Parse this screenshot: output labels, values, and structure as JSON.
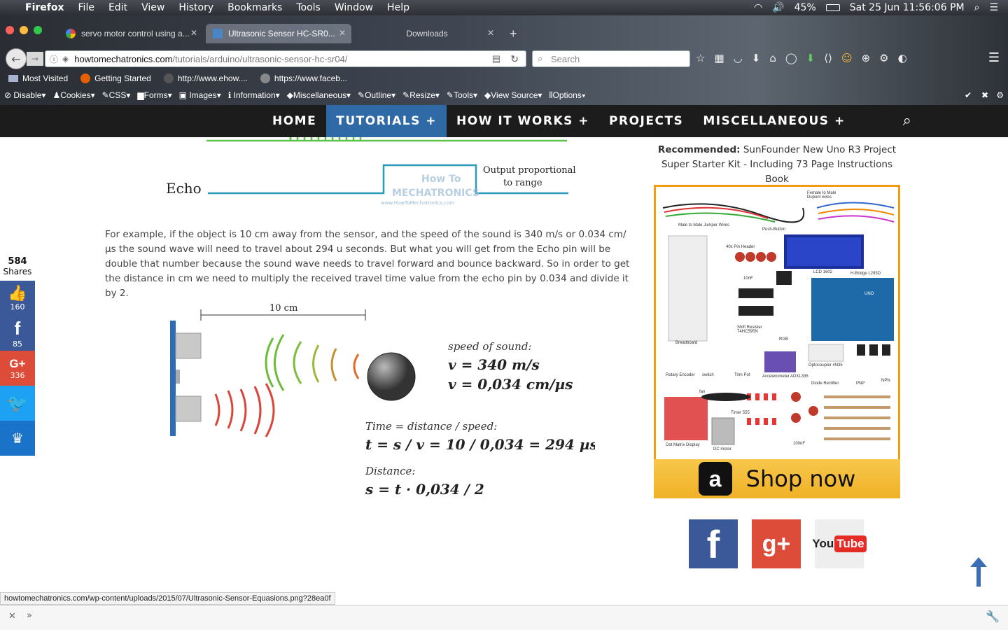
{
  "mac_menu": {
    "apple": "",
    "app": "Firefox",
    "items": [
      "File",
      "Edit",
      "View",
      "History",
      "Bookmarks",
      "Tools",
      "Window",
      "Help"
    ],
    "battery": "45%",
    "datetime": "Sat 25 Jun  11:56:06 PM"
  },
  "tabs": [
    {
      "title": "servo motor control using a...",
      "close": "✕"
    },
    {
      "title": "Ultrasonic Sensor HC-SR0...",
      "close": "✕"
    },
    {
      "title": "Downloads",
      "close": "✕"
    }
  ],
  "new_tab": "+",
  "url": {
    "host": "howtomechatronics.com",
    "path": "/tutorials/arduino/ultrasonic-sensor-hc-sr04/"
  },
  "search_placeholder": "Search",
  "bookmarks": [
    "Most Visited",
    "Getting Started",
    "http://www.ehow....",
    "https://www.faceb..."
  ],
  "devbar": [
    "Disable",
    "Cookies",
    "CSS",
    "Forms",
    "Images",
    "Information",
    "Miscellaneous",
    "Outline",
    "Resize",
    "Tools",
    "View Source",
    "Options"
  ],
  "site_nav": [
    "HOME",
    "TUTORIALS +",
    "HOW IT WORKS +",
    "PROJECTS",
    "MISCELLANEOUS +"
  ],
  "diagram_top": {
    "echo": "Echo",
    "output_line1": "Output proportional",
    "output_line2": "to range",
    "watermark1": "How To",
    "watermark2": "MECHATRONICS",
    "watermark_url": "www.HowToMechatronics.com"
  },
  "paragraph": "For example, if the object is 10 cm away from the sensor, and the speed of the sound is 340 m/s or 0.034 cm/µs the sound wave will need to travel about 294 u seconds. But what you will get from the Echo pin will be double that number because the sound wave needs to travel forward and bounce backward.  So in order to get the distance in cm we need to multiply the received travel time value from the echo pin by 0.034 and divide it by 2.",
  "equations": {
    "distance_label": "10 cm",
    "speed_title": "speed of sound:",
    "speed_v1": "v = 340 m/s",
    "speed_v2": "v = 0,034 cm/µs",
    "time_title": "Time = distance / speed:",
    "time_eq": "t = s / v = 10 / 0,034 = 294 µs",
    "dist_title": "Distance:",
    "dist_eq": "s = t · 0,034 / 2"
  },
  "share": {
    "total": "584",
    "total_label": "Shares",
    "buttons": [
      {
        "name": "like",
        "count": "160",
        "color": "#3b5998"
      },
      {
        "name": "facebook",
        "count": "85",
        "color": "#3b5998"
      },
      {
        "name": "google-plus",
        "count": "336",
        "color": "#dd4b39"
      },
      {
        "name": "twitter",
        "count": "",
        "color": "#1da1f2"
      },
      {
        "name": "sumome",
        "count": "",
        "color": "#1a73c8"
      }
    ]
  },
  "recommended": {
    "label": "Recommended:",
    "text": "SunFounder New Uno R3 Project Super Starter Kit - Including 73 Page Instructions Book"
  },
  "kit_labels": [
    "Female to Male Dupont wires",
    "Male to Male Jumper Wires",
    "Push-Button",
    "40x Pin Header",
    "10nF",
    "LCD 1602",
    "H-Bridge L293D",
    "Breadboard",
    "Shift Resister 74HC595N",
    "RGB",
    "UNO",
    "Rotary Encoder",
    "switch",
    "Trim Pot",
    "Accelerometer ADXL335",
    "Optocoupler 4N35",
    "Diode Rectifier",
    "PNP",
    "NPN",
    "fan",
    "Timer 555",
    "Dot Matrix Display",
    "DC motor",
    "100nF"
  ],
  "shop_now": "Shop now",
  "status_url": "howtomechatronics.com/wp-content/uploads/2015/07/Ultrasonic-Sensor-Equasions.png?28ea0f",
  "colors": {
    "nav_active": "#2f6aa6",
    "nav_bg": "#1c1c1c",
    "shop": "#f0b127"
  }
}
